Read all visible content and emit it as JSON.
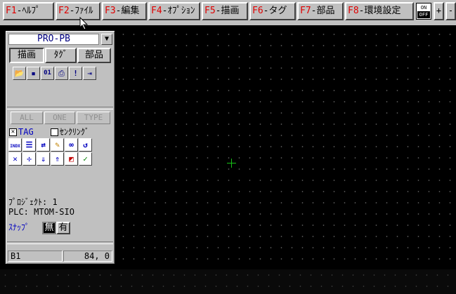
{
  "function_keys": [
    {
      "num": "F1",
      "name": "-ﾍﾙﾌﾟ"
    },
    {
      "num": "F2",
      "name": "-ﾌｧｲﾙ"
    },
    {
      "num": "F3",
      "name": "-編集"
    },
    {
      "num": "F4",
      "name": "-ｵﾌﾟｼｮﾝ"
    },
    {
      "num": "F5",
      "name": "-描画"
    },
    {
      "num": "F6",
      "name": "-タグ"
    },
    {
      "num": "F7",
      "name": "-部品"
    },
    {
      "num": "F8",
      "name": "-環境設定"
    }
  ],
  "toggle": {
    "on": "ON",
    "off": "OFF"
  },
  "mini_keys": {
    "plus": "+",
    "minus": "-"
  },
  "palette": {
    "title": "PRO-PB",
    "dropdown": "▼",
    "modes": [
      {
        "label": "描画",
        "active": true
      },
      {
        "label": "ﾀｸﾞ",
        "active": false
      },
      {
        "label": "部品",
        "active": false
      }
    ],
    "file_tools": [
      {
        "icon": "open-folder-icon",
        "glyph": "📂"
      },
      {
        "icon": "save-disk-icon",
        "glyph": "▪"
      },
      {
        "icon": "binary-io-icon",
        "glyph": "01"
      },
      {
        "icon": "print-icon",
        "glyph": "⎙"
      },
      {
        "icon": "exclamation-icon",
        "glyph": "!"
      },
      {
        "icon": "exit-door-icon",
        "glyph": "⇥"
      }
    ],
    "select_buttons": {
      "all": "ALL",
      "one": "ONE",
      "type": "TYPE"
    },
    "tag_check": {
      "label": "TAG",
      "checked": true
    },
    "link_check": {
      "label": "ｾﾝｸﾘﾝｸﾞ",
      "checked": false
    },
    "tag_tools_row1": [
      {
        "icon": "index-icon",
        "glyph": "INDX"
      },
      {
        "icon": "align-list-icon",
        "glyph": "☰"
      },
      {
        "icon": "swap-arrows-icon",
        "glyph": "⇄"
      },
      {
        "icon": "pencil-icon",
        "glyph": "✎"
      },
      {
        "icon": "find-binoculars-icon",
        "glyph": "∞"
      },
      {
        "icon": "undo-rotate-icon",
        "glyph": "↺"
      }
    ],
    "tag_tools_row2": [
      {
        "icon": "shrink-arrows-icon",
        "glyph": "✕"
      },
      {
        "icon": "expand-arrows-icon",
        "glyph": "✢"
      },
      {
        "icon": "move-down-icon",
        "glyph": "⇓"
      },
      {
        "icon": "move-up-icon",
        "glyph": "⇑"
      },
      {
        "icon": "color-palette-icon",
        "glyph": "◩"
      },
      {
        "icon": "check-edit-icon",
        "glyph": "✓"
      }
    ],
    "project_label": "ﾌﾟﾛｼﾞｪｸﾄ: 1",
    "plc_label": "PLC: MTOM-SIO",
    "snap_label": "ｽﾅｯﾌﾟ",
    "snap_off": "無",
    "snap_on": "有",
    "status_left": "B1",
    "status_right": "84,   0"
  }
}
